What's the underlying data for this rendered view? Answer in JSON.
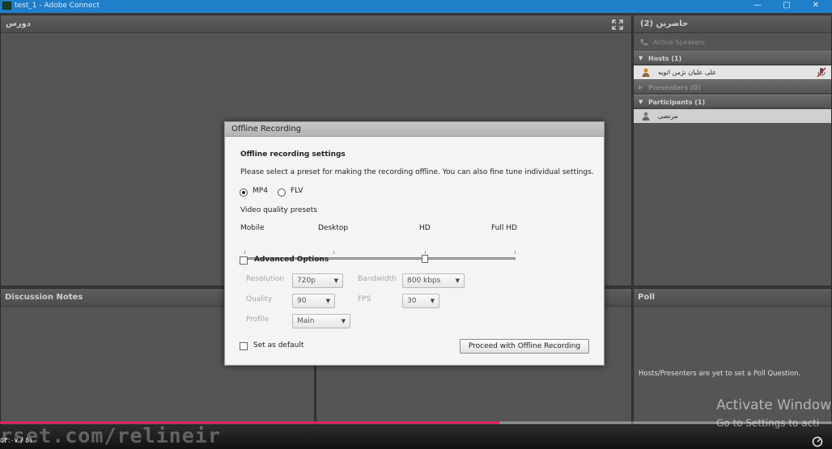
{
  "window": {
    "title": "test_1 - Adobe Connect",
    "accent": "#1f7fc9",
    "controls": [
      "minimize-icon",
      "maximize-icon",
      "close-icon"
    ]
  },
  "pods": {
    "share_title": "دورس",
    "attendees_title": "حاضرین (2)",
    "notes_title": "Discussion Notes",
    "poll_title": "Poll",
    "poll_message": "Hosts/Presenters are yet to set a Poll Question."
  },
  "attendees": {
    "active_speakers": "Active Speakers",
    "hosts_label": "Hosts (1)",
    "host_name": "علی علیان نژمن اتویه",
    "presenters_label": "Presenters (0)",
    "participants_label": "Participants (1)",
    "participant_name": "مرتضی"
  },
  "dialog": {
    "title": "Offline Recording",
    "heading": "Offline recording settings",
    "description": "Please select a preset for making the recording offline. You can also fine tune individual settings.",
    "format_options": [
      {
        "label": "MP4",
        "selected": true
      },
      {
        "label": "FLV",
        "selected": false
      }
    ],
    "presets_label": "Video quality presets",
    "preset_marks": [
      "Mobile",
      "Desktop",
      "HD",
      "Full HD"
    ],
    "selected_preset": "HD",
    "advanced_label": "Advanced Options",
    "advanced_checked": false,
    "resolution_label": "Resolution",
    "resolution_value": "720p",
    "bandwidth_label": "Bandwidth",
    "bandwidth_value": "800 kbps",
    "quality_label": "Quality",
    "quality_value": "90",
    "fps_label": "FPS",
    "fps_value": "30",
    "profile_label": "Profile",
    "profile_value": "Main",
    "default_label": "Set as default",
    "default_checked": false,
    "proceed_label": "Proceed with Offline Recording"
  },
  "player": {
    "watermark": "rset.com/relineir",
    "time": "٥١ / ٥٣:٠٧",
    "progress": 0.6,
    "progress_color": "#e0245e"
  },
  "os_notice": {
    "line1": "Activate Window",
    "line2": "Go to Settings to acti"
  }
}
